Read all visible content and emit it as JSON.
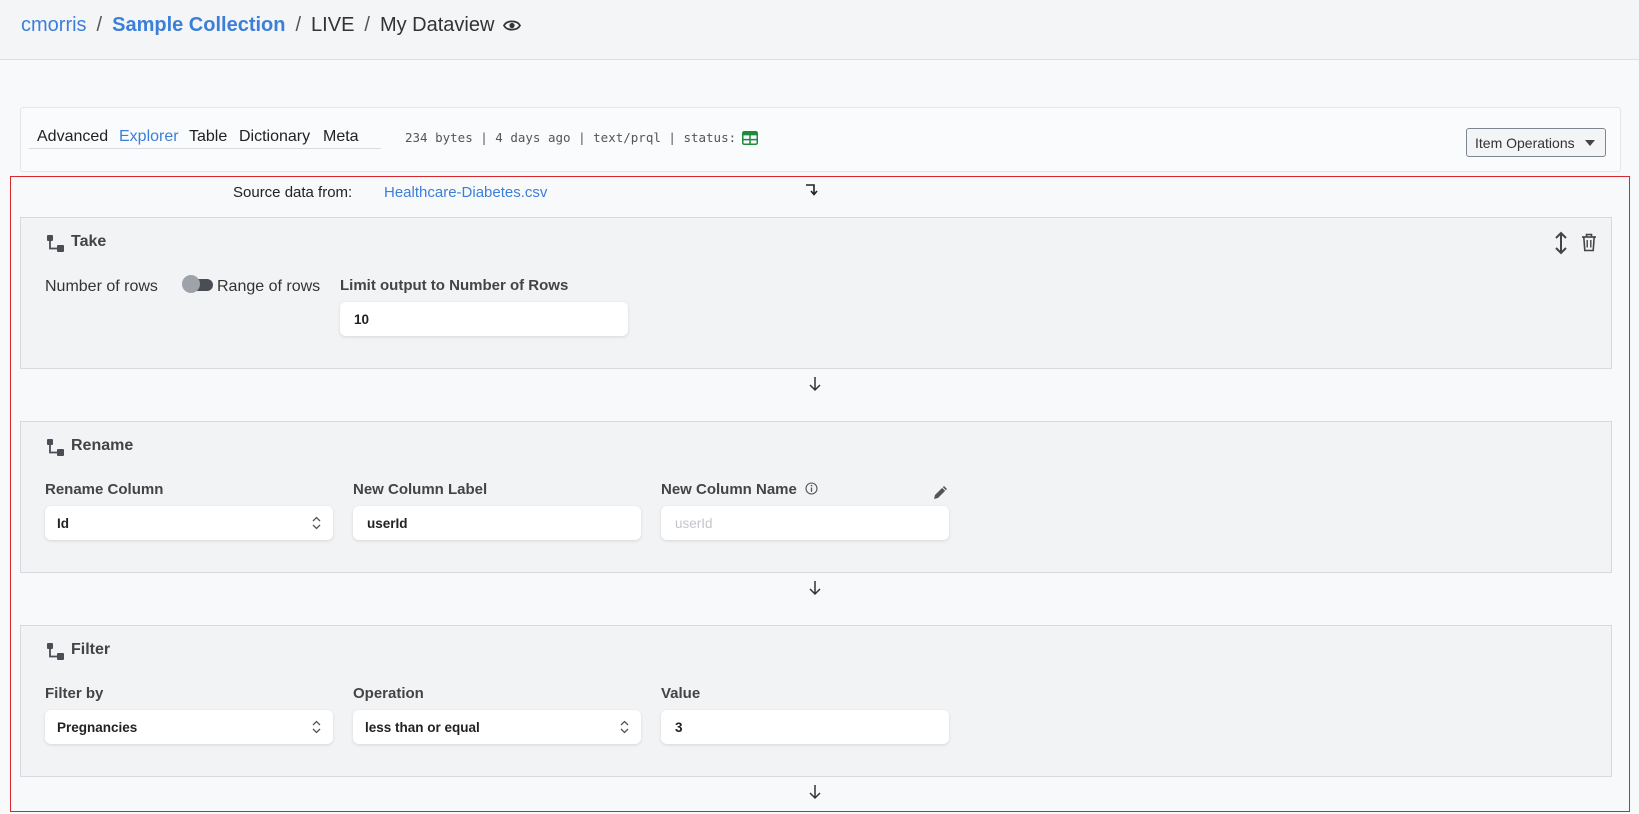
{
  "breadcrumb": {
    "user": "cmorris",
    "collection": "Sample Collection",
    "environment": "LIVE",
    "dataview": "My Dataview",
    "sep": "/"
  },
  "tabs": [
    {
      "label": "Advanced",
      "active": false
    },
    {
      "label": "Explorer",
      "active": true
    },
    {
      "label": "Table",
      "active": false
    },
    {
      "label": "Dictionary",
      "active": false
    },
    {
      "label": "Meta",
      "active": false
    }
  ],
  "meta": {
    "info": "234 bytes | 4 days ago | text/prql | status:",
    "status_color": "#1e8a3c"
  },
  "item_operations": {
    "label": "Item Operations"
  },
  "source": {
    "label": "Source data from:",
    "file": "Healthcare-Diabetes.csv"
  },
  "steps": {
    "take": {
      "title": "Take",
      "toggle_left": "Number of rows",
      "toggle_right": "Range of rows",
      "limit_label": "Limit output to Number of Rows",
      "limit_value": "10"
    },
    "rename": {
      "title": "Rename",
      "column_label": "Rename Column",
      "column_value": "Id",
      "new_label_label": "New Column Label",
      "new_label_value": "userId",
      "new_name_label": "New Column Name",
      "new_name_placeholder": "userId"
    },
    "filter": {
      "title": "Filter",
      "by_label": "Filter by",
      "by_value": "Pregnancies",
      "op_label": "Operation",
      "op_value": "less than or equal",
      "value_label": "Value",
      "value_value": "3"
    }
  },
  "colors": {
    "link": "#3c7fd8",
    "highlight_border": "#d9262b"
  }
}
